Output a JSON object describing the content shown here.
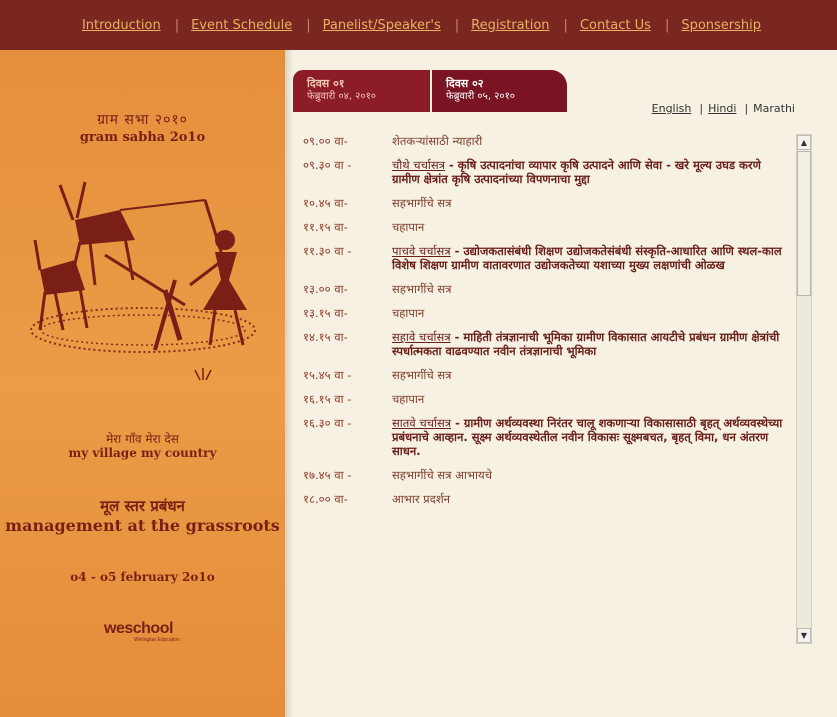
{
  "nav": {
    "items": [
      "Introduction",
      "Event Schedule",
      "Panelist/Speaker's",
      "Registration",
      "Contact Us",
      "Sponsership"
    ],
    "separator": "|"
  },
  "left": {
    "marathi_title": "ग्राम सभा २०१०",
    "english_title": "gram sabha 2o1o",
    "marathi_slogan": "मेरा गाँव मेरा देस",
    "english_slogan": "my village my country",
    "marathi_theme": "मूल स्तर प्रबंधन",
    "english_theme": "management at the grassroots",
    "dates": "o4 - o5 february 2o1o",
    "logo_text": "weschool",
    "logo_sub": "Welingkar Education"
  },
  "tabs": [
    {
      "title": "दिवस ०१",
      "date": "फेब्रुवारी ०४, २०१०"
    },
    {
      "title": "दिवस ०२",
      "date": "फेब्रुवारी ०५, २०१०"
    }
  ],
  "languages": {
    "english": "English",
    "hindi": "Hindi",
    "marathi": "Marathi"
  },
  "schedule": [
    {
      "time": "०९.०० वा-",
      "plain": "शेतकऱ्यांसाठी न्याहारी"
    },
    {
      "time": "०९.३० वा -",
      "link": "चौथे चर्चासत्र",
      "bold": " - कृषि उत्पादनांचा व्यापार कृषि उत्पादने आणि सेवा - खरे मूल्य उघड करणे ग्रामीण क्षेत्रांत कृषि उत्पादनांच्या विपणनाचा मुद्दा"
    },
    {
      "time": "१०.४५ वा-",
      "plain": "सहभागींचे सत्र"
    },
    {
      "time": "११.१५ वा-",
      "plain": "चहापान"
    },
    {
      "time": "११.३० वा -",
      "link": "पाचवे चर्चासत्र",
      "bold": " - उद्योजकतासंबंधी शिक्षण उद्योजकतेसंबंधी संस्कृति-आधारित आणि स्थल-काल विशेष शिक्षण ग्रामीण वातावरणात उद्योजकतेच्या यशाच्या मुख्य लक्षणांची ओळख"
    },
    {
      "time": "१३.०० वा-",
      "plain": "सहभागींचे सत्र"
    },
    {
      "time": "१३.१५ वा-",
      "plain": "चहापान"
    },
    {
      "time": "१४.१५ वा-",
      "link": "सहावे चर्चासत्र",
      "bold": " - माहिती तंत्रज्ञानाची भूमिका ग्रामीण विकासात आयटीचे प्रबंधन ग्रामीण क्षेत्रांची स्पर्धात्मकता वाढवण्यात नवीन तंत्रज्ञानाची भूमिका"
    },
    {
      "time": "१५.४५ वा -",
      "plain": "सहभागींचे सत्र"
    },
    {
      "time": "१६.१५ वा -",
      "plain": "चहापान"
    },
    {
      "time": "१६.३० वा -",
      "link": "सातवे चर्चासत्र",
      "bold": " - ग्रामीण अर्थव्यवस्था निरंतर चालू शकणाऱ्या विकासासाठी बृहत् अर्थव्यवस्थेच्या प्रबंधनाचे आव्हान. सूक्ष्म अर्थव्यवस्थेतील नवीन विकासः सूक्ष्मबचत, बृहत् विमा, धन अंतरण साधन."
    },
    {
      "time": "१७.४५ वा -",
      "plain": "सहभागींचे सत्र आभायचे"
    },
    {
      "time": "१८.०० वा-",
      "plain": "आभार प्रदर्शन"
    }
  ],
  "colors": {
    "maroon": "#7a2621",
    "orange": "#e9943f",
    "link": "#e8b262",
    "cream": "#f6f1e2"
  }
}
